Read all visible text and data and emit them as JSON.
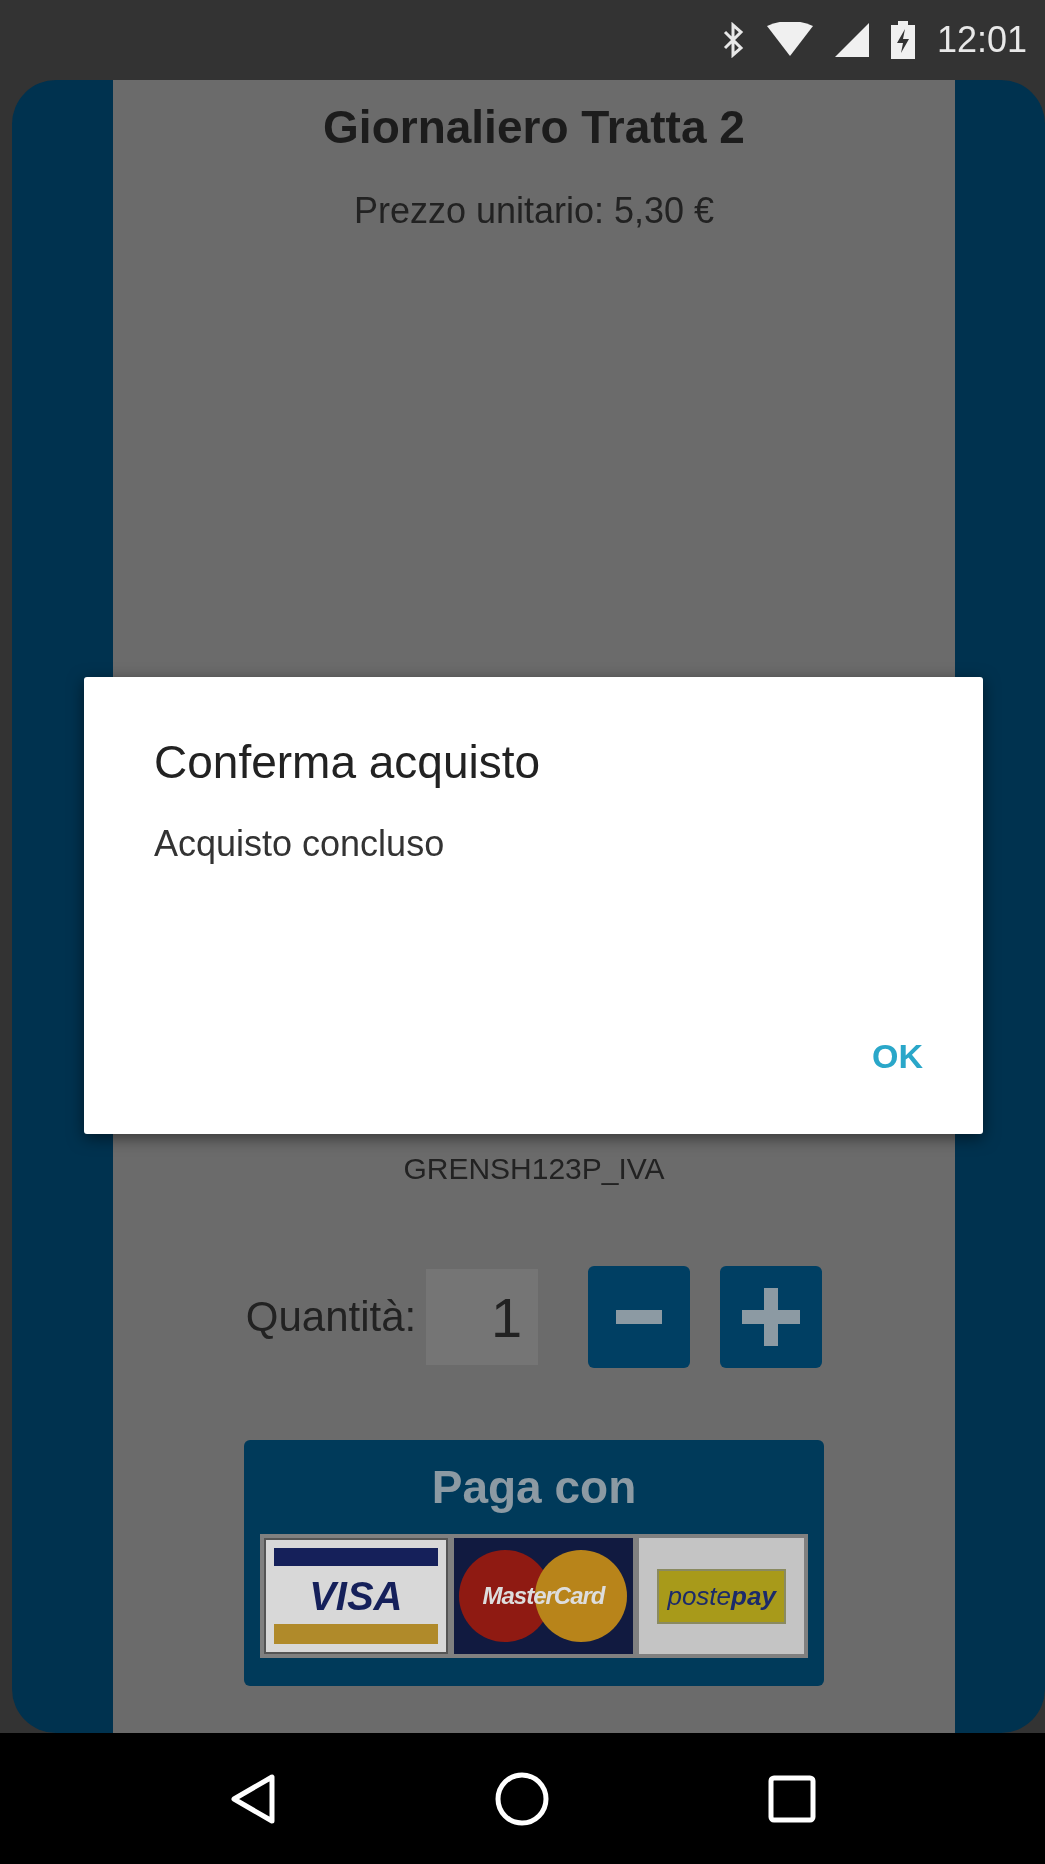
{
  "status_bar": {
    "time": "12:01"
  },
  "ticket": {
    "title": "Giornaliero Tratta 2",
    "unit_price": "Prezzo unitario: 5,30 €",
    "code": "GRENSH123P_IVA"
  },
  "quantity": {
    "label": "Quantità:",
    "value": "1"
  },
  "payment": {
    "label": "Paga con",
    "cards": [
      {
        "kind": "visa",
        "text": "VISA"
      },
      {
        "kind": "mastercard",
        "text": "MasterCard"
      },
      {
        "kind": "postepay",
        "text": "poste**pay**"
      }
    ]
  },
  "dialog": {
    "title": "Conferma acquisto",
    "message": "Acquisto concluso",
    "button": "OK"
  }
}
